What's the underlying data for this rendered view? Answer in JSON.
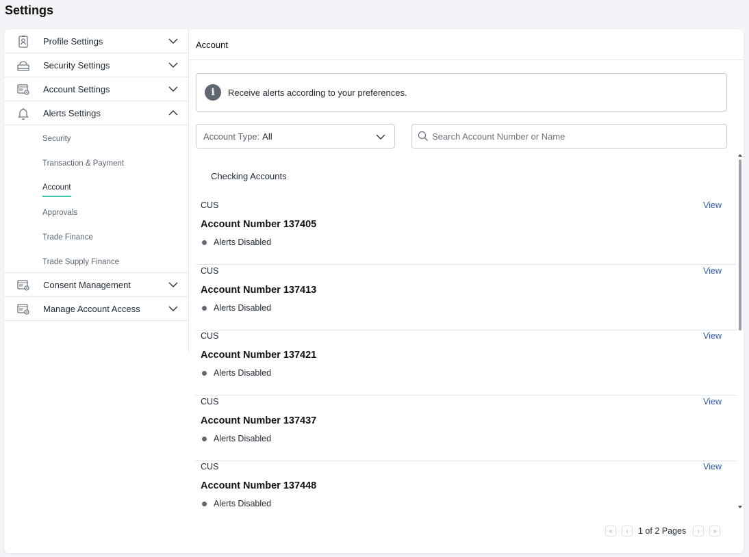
{
  "page": {
    "title": "Settings"
  },
  "sidebar": {
    "items": [
      {
        "label": "Profile Settings",
        "icon": "id-badge-icon",
        "expanded": false
      },
      {
        "label": "Security Settings",
        "icon": "router-icon",
        "expanded": false
      },
      {
        "label": "Account Settings",
        "icon": "account-gear-icon",
        "expanded": false
      },
      {
        "label": "Alerts Settings",
        "icon": "bell-gear-icon",
        "expanded": true
      },
      {
        "label": "Consent Management",
        "icon": "account-gear-icon",
        "expanded": false
      },
      {
        "label": "Manage Account Access",
        "icon": "account-gear-icon",
        "expanded": false
      }
    ],
    "alerts_sub": [
      "Security",
      "Transaction & Payment",
      "Account",
      "Approvals",
      "Trade Finance",
      "Trade Supply Finance"
    ],
    "active_sub": "Account"
  },
  "main": {
    "header": "Account",
    "info": "Receive alerts according to your preferences.",
    "filter": {
      "label": "Account Type:",
      "value": "All"
    },
    "search": {
      "placeholder": "Search Account Number or Name"
    },
    "group_title": "Checking Accounts",
    "accounts": [
      {
        "type": "CUS",
        "number": "Account Number 137405",
        "status": "Alerts Disabled",
        "action": "View"
      },
      {
        "type": "CUS",
        "number": "Account Number 137413",
        "status": "Alerts Disabled",
        "action": "View"
      },
      {
        "type": "CUS",
        "number": "Account Number 137421",
        "status": "Alerts Disabled",
        "action": "View"
      },
      {
        "type": "CUS",
        "number": "Account Number 137437",
        "status": "Alerts Disabled",
        "action": "View"
      },
      {
        "type": "CUS",
        "number": "Account Number 137448",
        "status": "Alerts Disabled",
        "action": "View"
      }
    ],
    "pager": {
      "text": "1 of 2 Pages"
    }
  },
  "colors": {
    "accent": "#3ec6a8",
    "link": "#2c5fa8",
    "status_dot": "#5f6770"
  }
}
